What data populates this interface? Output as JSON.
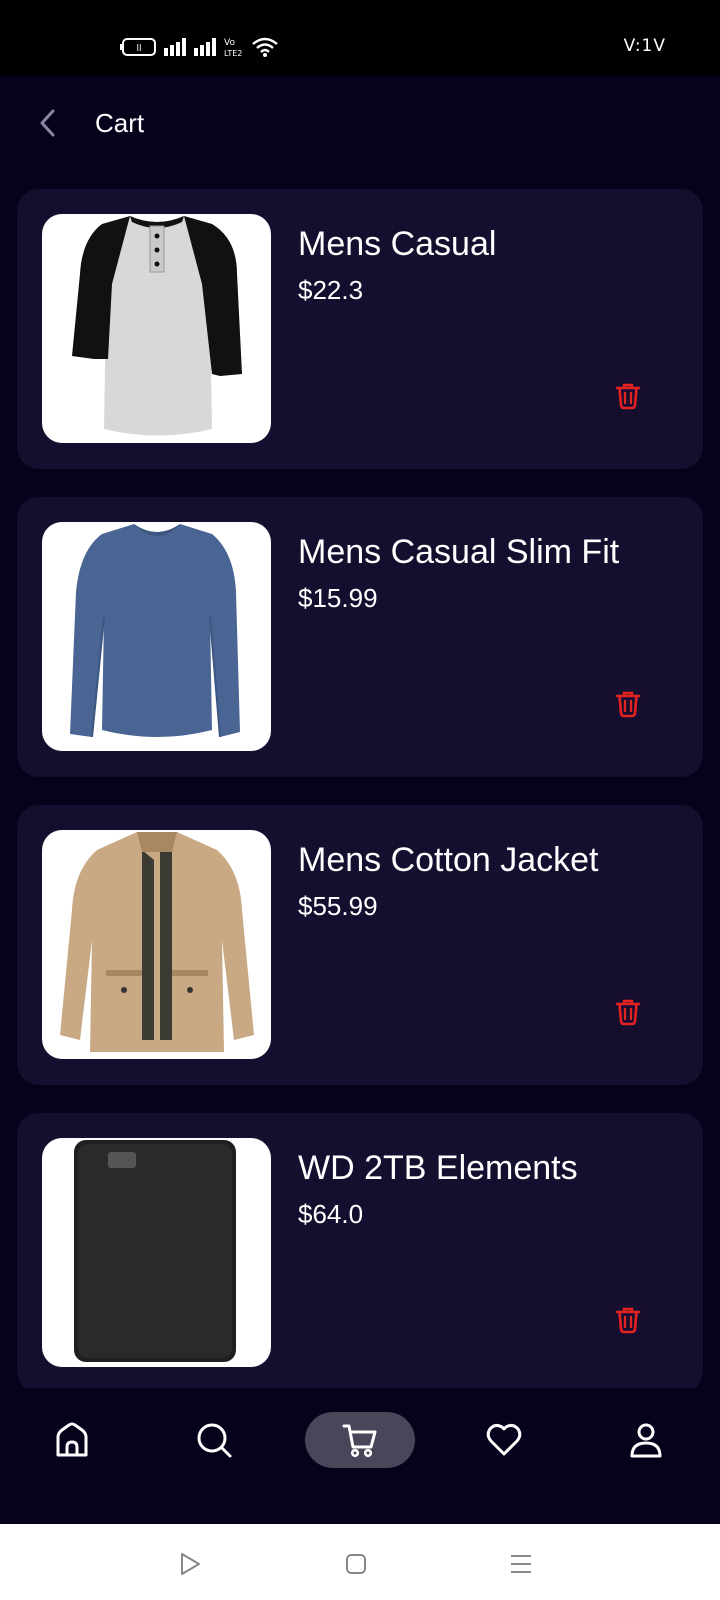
{
  "status_bar": {
    "time": "V:1V",
    "icons": [
      "battery-icon",
      "signal-icon",
      "signal-icon",
      "volte-icon",
      "wifi-icon"
    ]
  },
  "app_bar": {
    "title": "Cart",
    "back_icon": "back-arrow-icon"
  },
  "cart": {
    "items": [
      {
        "name": "Mens Casual",
        "price": "$22.3",
        "image": "raglan-shirt"
      },
      {
        "name": "Mens Casual Slim Fit",
        "price": "$15.99",
        "image": "blue-longsleeve"
      },
      {
        "name": "Mens Cotton Jacket",
        "price": "$55.99",
        "image": "khaki-jacket"
      },
      {
        "name": "WD 2TB Elements",
        "price": "$64.0",
        "image": "black-hard-drive"
      }
    ],
    "delete_icon": "trash-icon"
  },
  "bottom_nav": {
    "items": [
      "home-icon",
      "search-icon",
      "cart-icon",
      "heart-icon",
      "user-icon"
    ],
    "active": "cart-icon"
  },
  "colors": {
    "background": "#07021c",
    "card": "#150e2e",
    "delete": "#e52222",
    "nav_active": "#4a4558"
  }
}
